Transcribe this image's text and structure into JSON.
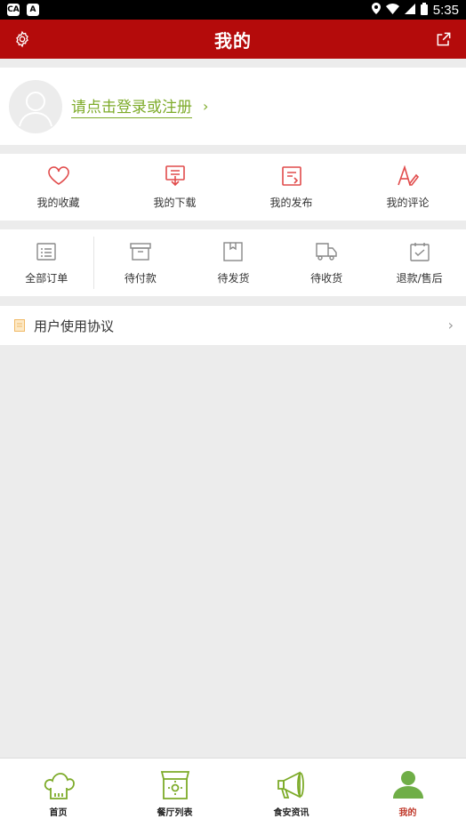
{
  "status_bar": {
    "time": "5:35",
    "left_icons": [
      "ca-icon",
      "a-icon"
    ]
  },
  "header": {
    "title": "我的"
  },
  "profile": {
    "login_prompt": "请点击登录或注册"
  },
  "quick_actions": [
    {
      "label": "我的收藏",
      "icon": "heart-icon"
    },
    {
      "label": "我的下载",
      "icon": "download-icon"
    },
    {
      "label": "我的发布",
      "icon": "publish-icon"
    },
    {
      "label": "我的评论",
      "icon": "comment-icon"
    }
  ],
  "orders": [
    {
      "label": "全部订单",
      "icon": "list-icon"
    },
    {
      "label": "待付款",
      "icon": "wallet-icon"
    },
    {
      "label": "待发货",
      "icon": "box-icon"
    },
    {
      "label": "待收货",
      "icon": "truck-icon"
    },
    {
      "label": "退款/售后",
      "icon": "calendar-check-icon"
    }
  ],
  "agreement": {
    "label": "用户使用协议"
  },
  "bottom_nav": [
    {
      "label": "首页",
      "icon": "chef-hat-icon",
      "active": false
    },
    {
      "label": "餐厅列表",
      "icon": "restaurant-icon",
      "active": false
    },
    {
      "label": "食安资讯",
      "icon": "megaphone-icon",
      "active": false
    },
    {
      "label": "我的",
      "icon": "user-icon",
      "active": true
    }
  ],
  "colors": {
    "header_bg": "#b40b0b",
    "accent_green": "#7dab29",
    "icon_red": "#e14b4b",
    "active_label": "#c0392b",
    "background": "#ececec"
  }
}
